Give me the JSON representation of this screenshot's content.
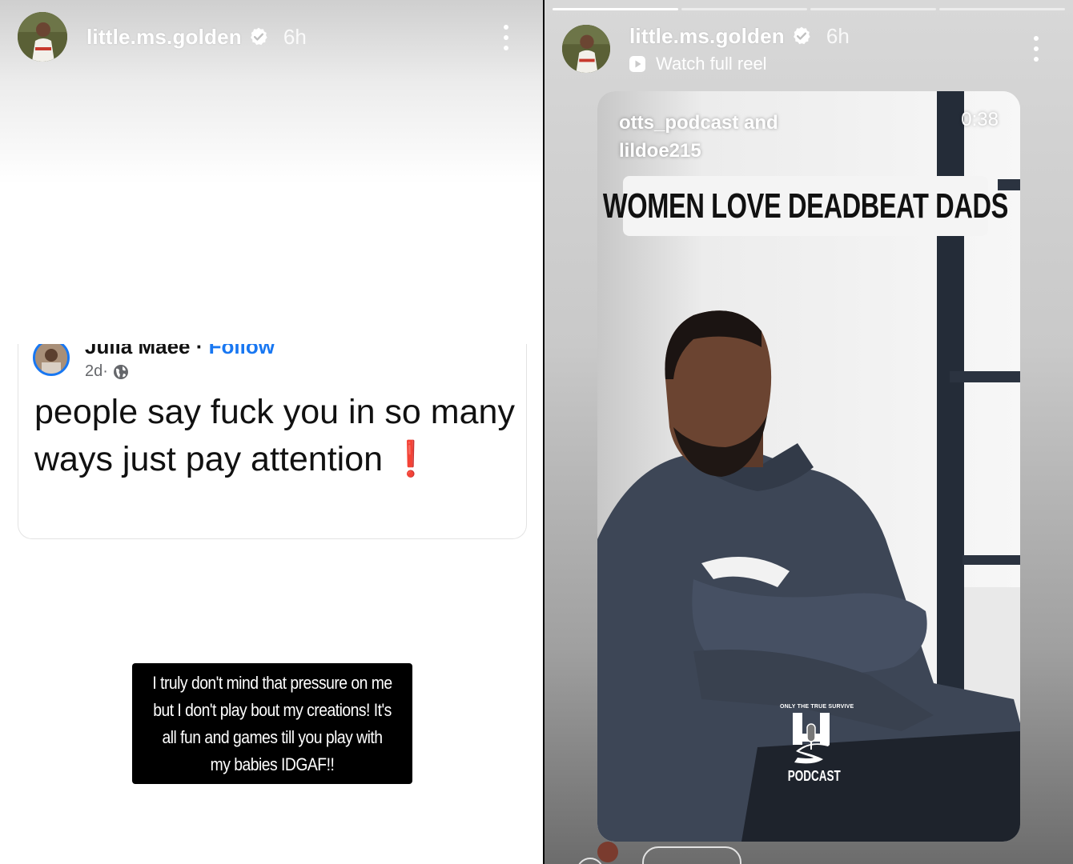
{
  "left_story": {
    "username": "little.ms.golden",
    "time": "6h",
    "facebook_post": {
      "author": "Julia Maee",
      "separator": " · ",
      "follow_label": "Follow",
      "age": "2d",
      "meta_dot": " · ",
      "text": "people say fuck you in so many ways just pay attention",
      "emoji": "❗"
    },
    "caption": "I truly don't mind that pressure on me but I don't play bout my creations! It's all fun and games till you play with my babies IDGAF!!"
  },
  "right_story": {
    "username": "little.ms.golden",
    "time": "6h",
    "watch_label": "Watch full reel",
    "progress": [
      1,
      0,
      0,
      0
    ],
    "reel": {
      "author": "otts_podcast and lildoe215",
      "duration": "0:38",
      "title": "WOMEN LOVE DEADBEAT DADS",
      "logo_top": "ONLY THE TRUE SURVIVE",
      "logo_bottom": "PODCAST"
    }
  },
  "colors": {
    "facebook_blue": "#1877f2",
    "emoji_red": "#e41e3f",
    "hoodie": "#3d4656"
  },
  "icons": [
    "verified-badge-icon",
    "more-options-icon",
    "globe-icon",
    "play-icon",
    "microphone-icon"
  ]
}
